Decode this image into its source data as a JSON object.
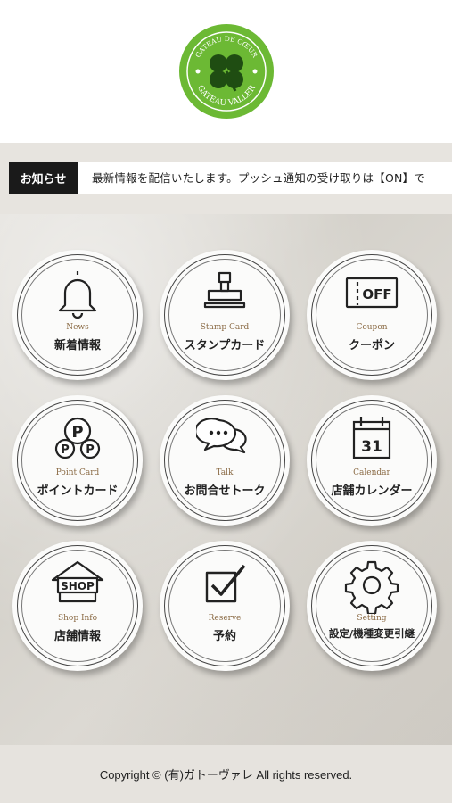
{
  "brand": {
    "logo_top": "GATEAU DE CŒUR",
    "logo_bottom": "GATEAU VALLER",
    "accent": "#6cb934"
  },
  "news": {
    "label": "お知らせ",
    "ticker": "最新情報を配信いたします。プッシュ通知の受け取りは【ON】で"
  },
  "tiles": [
    {
      "en": "News",
      "ja": "新着情報",
      "icon": "bell-icon"
    },
    {
      "en": "Stamp Card",
      "ja": "スタンプカード",
      "icon": "stamp-icon"
    },
    {
      "en": "Coupon",
      "ja": "クーポン",
      "icon": "coupon-icon",
      "icon_text": "OFF"
    },
    {
      "en": "Point Card",
      "ja": "ポイントカード",
      "icon": "points-icon",
      "icon_text": "P"
    },
    {
      "en": "Talk",
      "ja": "お問合せトーク",
      "icon": "chat-icon"
    },
    {
      "en": "Calendar",
      "ja": "店舗カレンダー",
      "icon": "calendar-icon",
      "icon_text": "31"
    },
    {
      "en": "Shop Info",
      "ja": "店舗情報",
      "icon": "shop-icon",
      "icon_text": "SHOP"
    },
    {
      "en": "Reserve",
      "ja": "予約",
      "icon": "checkbox-icon"
    },
    {
      "en": "Setting",
      "ja": "設定/機種変更引継",
      "icon": "gear-icon"
    }
  ],
  "footer": {
    "copyright": "Copyright © (有)ガトーヴァレ All rights reserved."
  }
}
